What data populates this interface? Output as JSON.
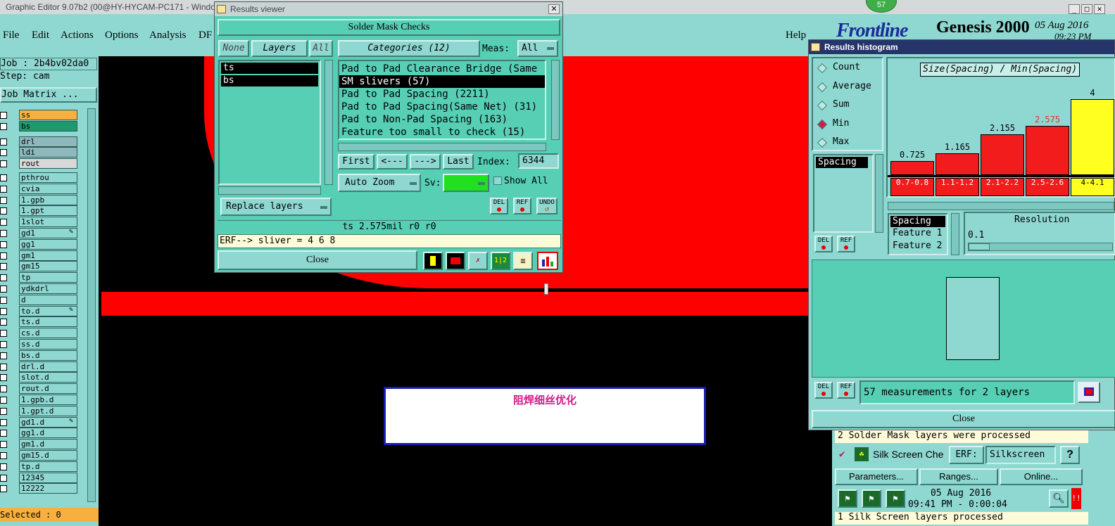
{
  "main_window": {
    "title": "Graphic Editor 9.07b2 (00@HY-HYCAM-PC171 - Windo",
    "menu": [
      "File",
      "Edit",
      "Actions",
      "Options",
      "Analysis",
      "DF"
    ],
    "help": "Help",
    "app_name": "Genesis 2000",
    "brand": "Frontline",
    "date": "05 Aug 2016",
    "time": "09:23 PM",
    "badge": "57",
    "job": "Job : 2b4bv02da0",
    "step": "Step: cam",
    "job_matrix": "Job Matrix ...",
    "selected": "Selected : 0"
  },
  "layers": [
    {
      "name": "ss",
      "color": "#f7b040",
      "mark": ""
    },
    {
      "name": "bs",
      "color": "#1d9a6c",
      "mark": ""
    },
    {
      "name": "drl",
      "color": "#8fb8bc",
      "mark": ""
    },
    {
      "name": "ldi",
      "color": "#8fb8bc",
      "mark": ""
    },
    {
      "name": "rout",
      "color": "#d8d8d8",
      "mark": ""
    },
    {
      "name": "pthrou",
      "color": "#8fd8d2",
      "mark": ""
    },
    {
      "name": "cvia",
      "color": "#8fd8d2",
      "mark": ""
    },
    {
      "name": "1.gpb",
      "color": "#8fd8d2",
      "mark": ""
    },
    {
      "name": "1.gpt",
      "color": "#8fd8d2",
      "mark": ""
    },
    {
      "name": "1slot",
      "color": "#8fd8d2",
      "mark": ""
    },
    {
      "name": "gd1",
      "color": "#8fd8d2",
      "mark": "✎"
    },
    {
      "name": "gg1",
      "color": "#8fd8d2",
      "mark": ""
    },
    {
      "name": "gm1",
      "color": "#8fd8d2",
      "mark": ""
    },
    {
      "name": "gm15",
      "color": "#8fd8d2",
      "mark": ""
    },
    {
      "name": "tp",
      "color": "#8fd8d2",
      "mark": ""
    },
    {
      "name": "ydkdrl",
      "color": "#8fd8d2",
      "mark": ""
    },
    {
      "name": "d",
      "color": "#8fd8d2",
      "mark": ""
    },
    {
      "name": "to.d",
      "color": "#8fd8d2",
      "mark": "✎"
    },
    {
      "name": "ts.d",
      "color": "#8fd8d2",
      "mark": ""
    },
    {
      "name": "cs.d",
      "color": "#8fd8d2",
      "mark": ""
    },
    {
      "name": "ss.d",
      "color": "#8fd8d2",
      "mark": ""
    },
    {
      "name": "bs.d",
      "color": "#8fd8d2",
      "mark": ""
    },
    {
      "name": "drl.d",
      "color": "#8fd8d2",
      "mark": ""
    },
    {
      "name": "slot.d",
      "color": "#8fd8d2",
      "mark": ""
    },
    {
      "name": "rout.d",
      "color": "#8fd8d2",
      "mark": ""
    },
    {
      "name": "1.gpb.d",
      "color": "#8fd8d2",
      "mark": ""
    },
    {
      "name": "1.gpt.d",
      "color": "#8fd8d2",
      "mark": ""
    },
    {
      "name": "gd1.d",
      "color": "#8fd8d2",
      "mark": "✎"
    },
    {
      "name": "gg1.d",
      "color": "#8fd8d2",
      "mark": ""
    },
    {
      "name": "gm1.d",
      "color": "#8fd8d2",
      "mark": ""
    },
    {
      "name": "gm15.d",
      "color": "#8fd8d2",
      "mark": ""
    },
    {
      "name": "tp.d",
      "color": "#8fd8d2",
      "mark": ""
    },
    {
      "name": "12345",
      "color": "#8fd8d2",
      "mark": ""
    },
    {
      "name": "12222",
      "color": "#8fd8d2",
      "mark": ""
    }
  ],
  "results_viewer": {
    "title": "Results viewer",
    "heading": "Solder Mask Checks",
    "none": "None",
    "layers": "Layers",
    "all": "All",
    "categories": "Categories (12)",
    "meas_label": "Meas:",
    "meas_value": "All",
    "layer_list": [
      "ts",
      "bs"
    ],
    "category_list": [
      "Pad to Pad Clearance Bridge (Same",
      "SM slivers (57)",
      "Pad to Pad Spacing (2211)",
      "Pad to Pad Spacing(Same Net) (31)",
      "Pad to Non-Pad Spacing (163)",
      "Feature too small to check (15)"
    ],
    "first": "First",
    "prev": "<---",
    "next": "--->",
    "last": "Last",
    "index_label": "Index:",
    "index_value": "6344",
    "auto_zoom": "Auto Zoom",
    "sv_label": "Sv:",
    "show_all": "Show All",
    "replace_layers": "Replace layers",
    "del": "DEL",
    "ref": "REF",
    "undo": "UNDO",
    "status": "ts 2.575mil  r0  r0",
    "erf": "ERF--> sliver = 4 6 8",
    "close": "Close"
  },
  "overlay_text": "阻焊细丝优化",
  "histogram": {
    "title": "Results histogram",
    "options": [
      "Count",
      "Average",
      "Sum",
      "Min",
      "Max"
    ],
    "selected_option": "Min",
    "chart_title": "Size(Spacing) / Min(Spacing)",
    "list_item": "Spacing",
    "feature_list": [
      "Spacing",
      "Feature 1",
      "Feature 2"
    ],
    "resolution_label": "Resolution",
    "resolution_value": "0.1",
    "summary": "57 measurements for 2 layers",
    "close": "Close",
    "del": "DEL",
    "ref": "REF"
  },
  "chart_data": {
    "type": "bar",
    "categories": [
      "0.7-0.8",
      "1.1-1.2",
      "2.1-2.2",
      "2.5-2.6",
      "4-4.1"
    ],
    "values": [
      0.725,
      1.165,
      2.155,
      2.575,
      4
    ],
    "value_labels": [
      "0.725",
      "1.165",
      "2.155",
      "2.575",
      "4"
    ],
    "colors": [
      "#f21c1c",
      "#f21c1c",
      "#f21c1c",
      "#f21c1c",
      "#ffff20"
    ],
    "label_colors": [
      "#000000",
      "#000000",
      "#000000",
      "#e03030",
      "#000000"
    ],
    "title": "Size(Spacing) / Min(Spacing)",
    "ylim": [
      0,
      4
    ]
  },
  "bottom_panel": {
    "msg1": "2 Solder Mask layers were processed",
    "check_name": "Silk Screen Che",
    "erf_label": "ERF:",
    "erf_value": "Silkscreen",
    "help": "?",
    "params": "Parameters...",
    "ranges": "Ranges...",
    "online": "Online...",
    "date": "05 Aug 2016",
    "time": "09:41 PM - 0:00:04",
    "msg2": "1 Silk Screen layers processed"
  }
}
